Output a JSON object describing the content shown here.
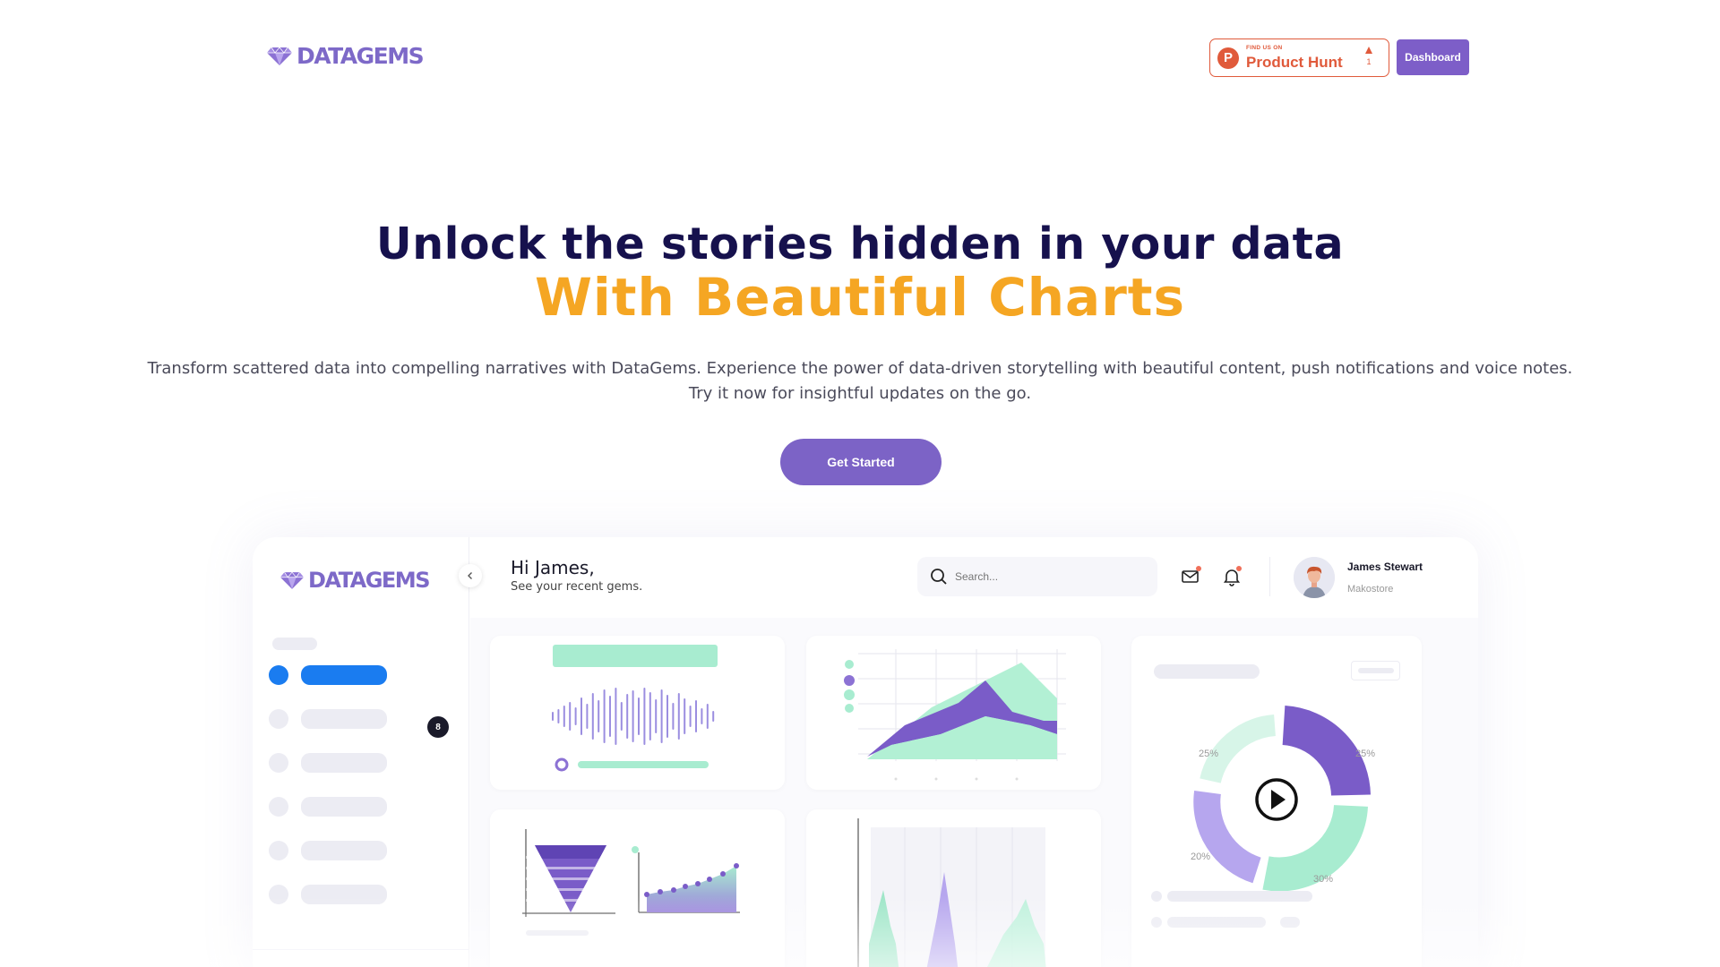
{
  "nav": {
    "logo_text": "DATAGEMS",
    "product_hunt": {
      "small_label": "FIND US ON",
      "name": "Product Hunt",
      "letter": "P",
      "votes": "1"
    },
    "dashboard_button": "Dashboard"
  },
  "hero": {
    "title": "Unlock the stories hidden in your data",
    "subtitle": "With Beautiful Charts",
    "description_line1": "Transform scattered data into compelling narratives with DataGems. Experience the power of data-driven storytelling with beautiful content, push notifications and voice notes.",
    "description_line2": "Try it now for insightful updates on the go.",
    "cta": "Get Started"
  },
  "mock": {
    "logo_text": "DATAGEMS",
    "greeting": "Hi James,",
    "greeting_sub": "See your recent gems.",
    "search_placeholder": "Search...",
    "user_name": "James Stewart",
    "user_company": "Makostore",
    "nav_badge": "8",
    "donut_labels": [
      "25%",
      "25%",
      "20%",
      "30%"
    ]
  },
  "colors": {
    "brand_purple": "#7d5ec8",
    "accent_orange": "#f5a623",
    "title_navy": "#16114d",
    "mint": "#a8ecd0",
    "lavender": "#b6a6ee"
  },
  "icons": [
    "diamond-icon",
    "product-hunt-icon",
    "upvote-arrow-icon",
    "chevron-left-icon",
    "search-icon",
    "mail-icon",
    "bell-icon",
    "play-icon"
  ]
}
